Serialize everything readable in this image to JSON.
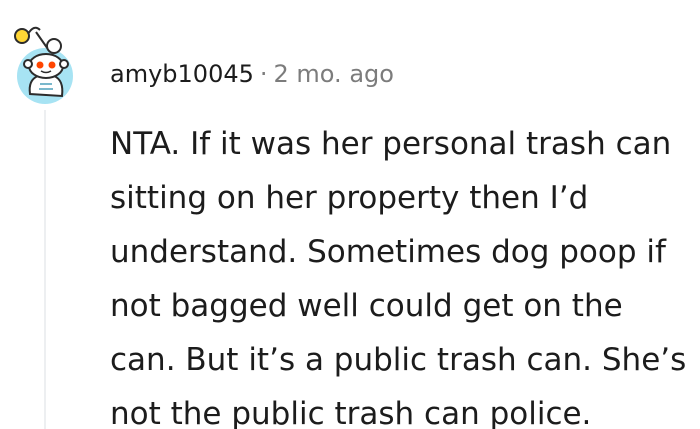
{
  "comment": {
    "avatar_icon": "snoo-avatar-icon",
    "username": "amyb10045",
    "separator": "·",
    "timestamp": "2 mo. ago",
    "body_lines": [
      "NTA. If it was her personal trash can",
      "sitting on her property then I’d",
      "understand. Sometimes dog poop if",
      "not bagged well could get on the",
      "can. But it’s a public trash can. She’s",
      "not the public trash can police."
    ]
  },
  "colors": {
    "text": "#1c1c1c",
    "meta": "#7c7c7c",
    "thread_line": "#edeff1",
    "avatar_bg": "#a7e3f3",
    "avatar_accent": "#ff4500",
    "antenna_ball": "#ffd635"
  }
}
